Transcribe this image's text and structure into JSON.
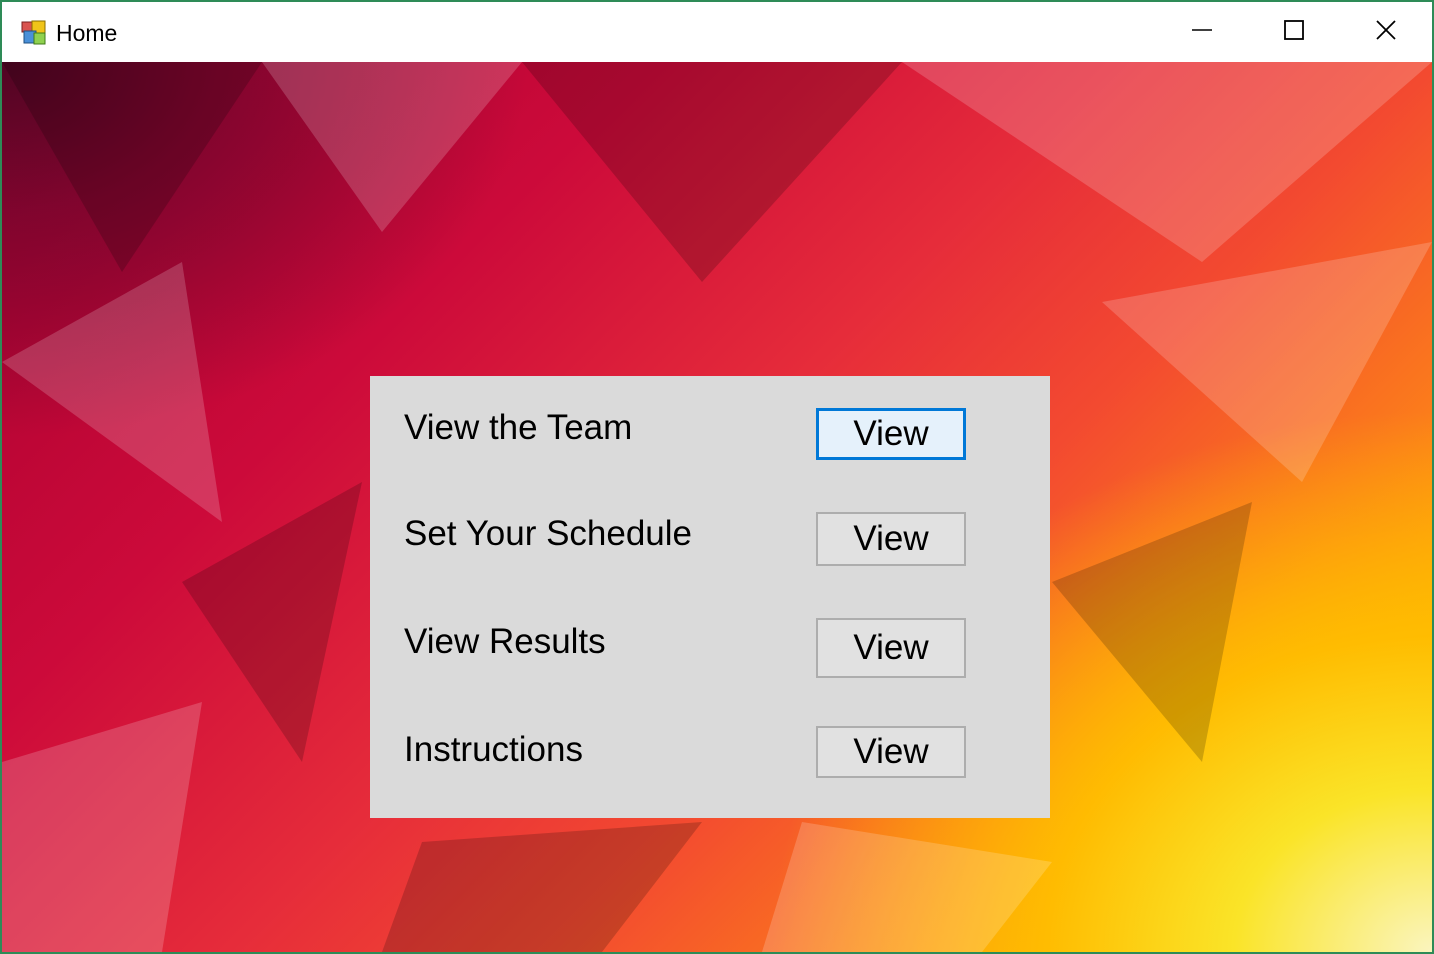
{
  "window": {
    "title": "Home",
    "controls": {
      "minimize_icon": "minimize-icon",
      "maximize_icon": "maximize-icon",
      "close_icon": "close-icon"
    },
    "app_icon": "app-icon"
  },
  "menu_panel": {
    "rows": [
      {
        "label": "View the Team",
        "button_label": "View",
        "focused": true
      },
      {
        "label": "Set Your Schedule",
        "button_label": "View",
        "focused": false
      },
      {
        "label": "View Results",
        "button_label": "View",
        "focused": false
      },
      {
        "label": "Instructions",
        "button_label": "View",
        "focused": false
      }
    ]
  },
  "colors": {
    "window_border": "#2e8b57",
    "panel_background": "#dadada",
    "focus_border": "#0078d7",
    "background_dark": "#50052a",
    "background_red": "#cc0a3a",
    "background_orange": "#fb7a1c",
    "background_yellow": "#ffd400"
  }
}
